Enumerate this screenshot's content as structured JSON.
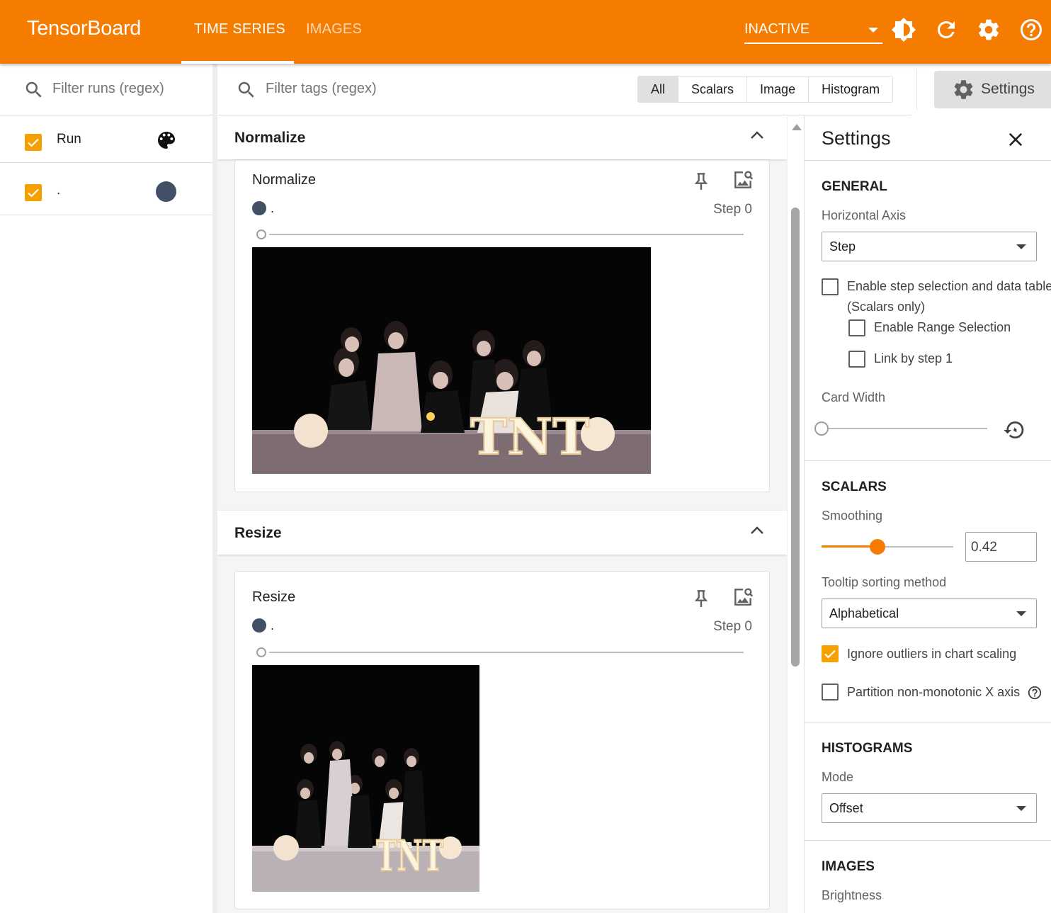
{
  "header": {
    "brand": "TensorBoard",
    "tabs": [
      {
        "label": "TIME SERIES",
        "active": true
      },
      {
        "label": "IMAGES",
        "active": false
      }
    ],
    "reload_status": "INACTIVE",
    "icons": [
      "brightness-icon",
      "refresh-icon",
      "gear-icon",
      "help-icon"
    ],
    "accent_color": "#f57c00"
  },
  "runs": {
    "filter_placeholder": "Filter runs (regex)",
    "header_label": "Run",
    "items": [
      {
        "label": ".",
        "checked": true,
        "color": "#425066"
      }
    ]
  },
  "main": {
    "filter_placeholder": "Filter tags (regex)",
    "type_filters": [
      {
        "label": "All",
        "active": true
      },
      {
        "label": "Scalars",
        "active": false
      },
      {
        "label": "Image",
        "active": false
      },
      {
        "label": "Histogram",
        "active": false
      }
    ],
    "settings_button": "Settings",
    "groups": [
      {
        "title": "Normalize",
        "card": {
          "title": "Normalize",
          "run": ".",
          "step": "Step 0",
          "image_caption": "TNT"
        }
      },
      {
        "title": "Resize",
        "card": {
          "title": "Resize",
          "run": ".",
          "step": "Step 0",
          "image_caption": "TNT"
        }
      }
    ]
  },
  "settings": {
    "title": "Settings",
    "general": {
      "heading": "GENERAL",
      "horizontal_axis_label": "Horizontal Axis",
      "horizontal_axis_value": "Step",
      "step_selection_label": "Enable step selection and data table",
      "step_selection_sub": "(Scalars only)",
      "step_selection_checked": false,
      "range_selection_label": "Enable Range Selection",
      "range_selection_checked": false,
      "link_by_step_label": "Link by step 1",
      "link_by_step_checked": false,
      "card_width_label": "Card Width"
    },
    "scalars": {
      "heading": "SCALARS",
      "smoothing_label": "Smoothing",
      "smoothing_value": "0.42",
      "tooltip_sort_label": "Tooltip sorting method",
      "tooltip_sort_value": "Alphabetical",
      "ignore_outliers_label": "Ignore outliers in chart scaling",
      "ignore_outliers_checked": true,
      "partition_label": "Partition non-monotonic X axis",
      "partition_checked": false
    },
    "histograms": {
      "heading": "HISTOGRAMS",
      "mode_label": "Mode",
      "mode_value": "Offset"
    },
    "images": {
      "heading": "IMAGES",
      "brightness_label": "Brightness"
    }
  }
}
